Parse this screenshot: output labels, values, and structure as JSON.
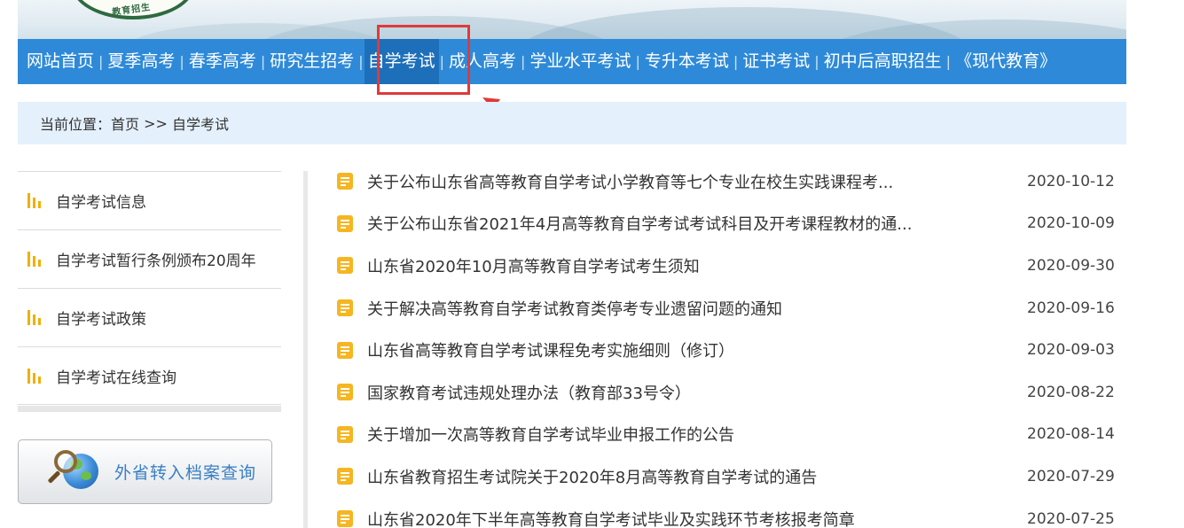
{
  "header": {
    "emblem_text": "教育招生"
  },
  "nav": {
    "items": [
      {
        "label": "网站首页"
      },
      {
        "label": "夏季高考"
      },
      {
        "label": "春季高考"
      },
      {
        "label": "研究生招考"
      },
      {
        "label": "自学考试",
        "active": true
      },
      {
        "label": "成人高考"
      },
      {
        "label": "学业水平考试"
      },
      {
        "label": "专升本考试"
      },
      {
        "label": "证书考试"
      },
      {
        "label": "初中后高职招生"
      },
      {
        "label": "《现代教育》"
      }
    ],
    "separator": "|",
    "color": "#2e8ad8"
  },
  "breadcrumb": {
    "prefix": "当前位置：",
    "home": "首页",
    "sep": " >> ",
    "current": "自学考试"
  },
  "sidebar": {
    "items": [
      {
        "label": "自学考试信息"
      },
      {
        "label": "自学考试暂行条例颁布20周年"
      },
      {
        "label": "自学考试政策"
      },
      {
        "label": "自学考试在线查询"
      }
    ],
    "archive_button": "外省转入档案查询",
    "bar_icon_color": "#f0b000"
  },
  "news": {
    "items": [
      {
        "title": "关于公布山东省高等教育自学考试小学教育等七个专业在校生实践课程考...",
        "date": "2020-10-12"
      },
      {
        "title": "关于公布山东省2021年4月高等教育自学考试考试科目及开考课程教材的通...",
        "date": "2020-10-09"
      },
      {
        "title": "山东省2020年10月高等教育自学考试考生须知",
        "date": "2020-09-30"
      },
      {
        "title": "关于解决高等教育自学考试教育类停考专业遗留问题的通知",
        "date": "2020-09-16"
      },
      {
        "title": "山东省高等教育自学考试课程免考实施细则（修订）",
        "date": "2020-09-03"
      },
      {
        "title": "国家教育考试违规处理办法（教育部33号令）",
        "date": "2020-08-22"
      },
      {
        "title": "关于增加一次高等教育自学考试毕业申报工作的公告",
        "date": "2020-08-14"
      },
      {
        "title": "山东省教育招生考试院关于2020年8月高等教育自学考试的通告",
        "date": "2020-07-29"
      },
      {
        "title": "山东省2020年下半年高等教育自学考试毕业及实践环节考核报考简章",
        "date": "2020-07-25"
      }
    ],
    "icon_color": "#f5b622"
  },
  "annotation": {
    "color": "#e03a3a"
  }
}
